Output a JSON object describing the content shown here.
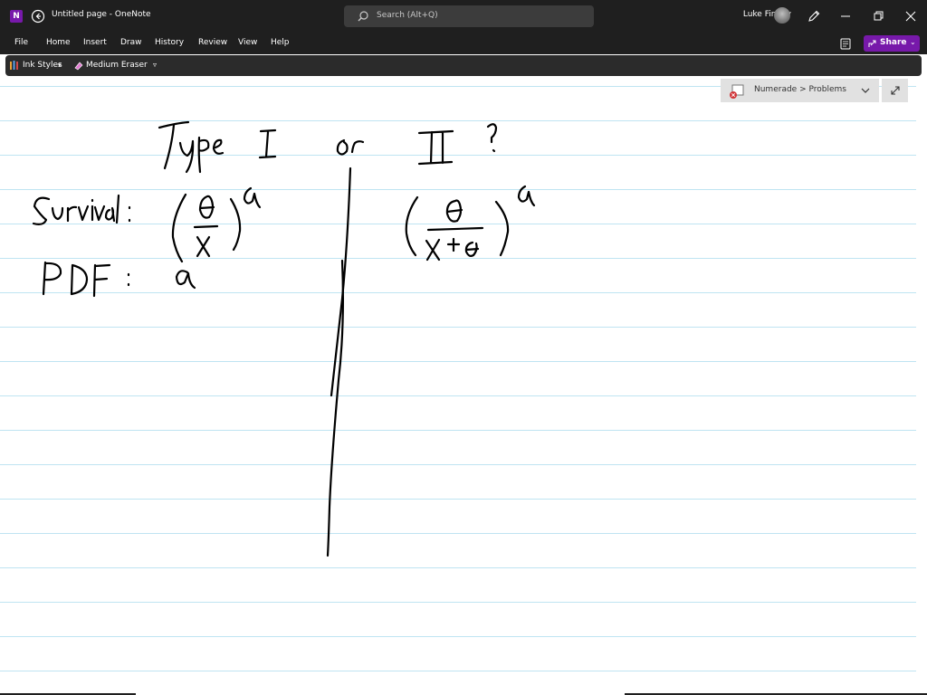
{
  "app": {
    "logo_letter": "N",
    "title": "Untitled page - OneNote",
    "search_placeholder": "Search (Alt+Q)",
    "user_name": "Luke Finney"
  },
  "ribbon": {
    "tabs": [
      "File",
      "Home",
      "Insert",
      "Draw",
      "History",
      "Review",
      "View",
      "Help"
    ],
    "share_label": "Share"
  },
  "toolbar": {
    "ink_styles_label": "Ink Styles",
    "eraser_label": "Medium Eraser"
  },
  "notebook": {
    "location": "Numerade > Problems"
  },
  "colors": {
    "chrome": "#1f1f1f",
    "toolbar": "#2b2b2b",
    "accent": "#7719aa",
    "rule_line": "#bfe4f2",
    "ink": "#000000"
  },
  "icons": {
    "logo": "onenote-logo-icon",
    "back": "back-arrow-icon",
    "search": "search-icon",
    "pen": "pen-icon",
    "minimize": "minimize-icon",
    "restore": "restore-icon",
    "close": "close-icon",
    "immersive": "immersive-reader-icon",
    "share": "share-icon",
    "ink_styles": "ink-styles-icon",
    "eraser": "eraser-icon",
    "more": "more-tools-icon",
    "notebook": "notebook-sync-error-icon",
    "chevron": "chevron-down-icon",
    "expand": "expand-icon"
  }
}
